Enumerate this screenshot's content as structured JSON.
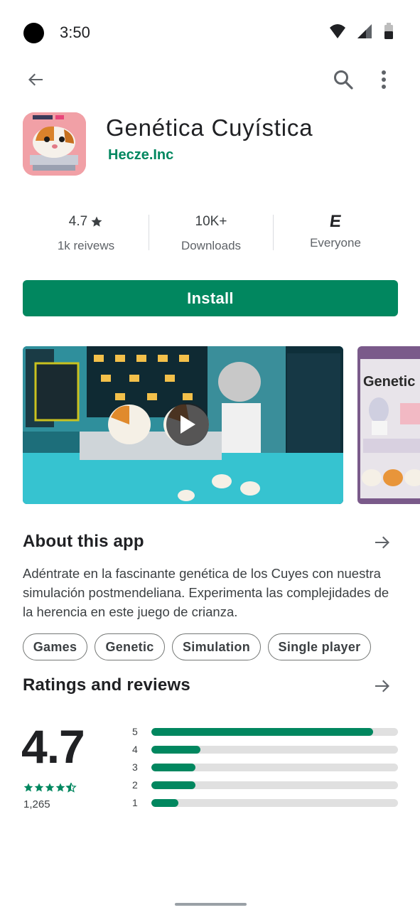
{
  "status_bar": {
    "time": "3:50"
  },
  "app": {
    "title": "Genética Cuyística",
    "developer": "Hecze.Inc",
    "icon": "guinea-pig-pixel-icon"
  },
  "stats": {
    "rating": {
      "value": "4.7",
      "label": "1k reivews"
    },
    "downloads": {
      "value": "10K+",
      "label": "Downloads"
    },
    "content_rating": {
      "value": "E",
      "label": "Everyone"
    }
  },
  "install": {
    "label": "Install"
  },
  "screenshots": {
    "second_text": "Genetic"
  },
  "about": {
    "title": "About this app",
    "description": "Adéntrate en la fascinante genética de los Cuyes con nuestra simulación postmendeliana. Experimenta las complejidades de la herencia en este juego de crianza."
  },
  "tags": [
    "Games",
    "Genetic",
    "Simulation",
    "Single player"
  ],
  "ratings": {
    "title": "Ratings and reviews",
    "average": "4.7",
    "count": "1,265",
    "star_value": 4.5,
    "distribution": [
      {
        "label": "5",
        "fraction": 0.9
      },
      {
        "label": "4",
        "fraction": 0.2
      },
      {
        "label": "3",
        "fraction": 0.18
      },
      {
        "label": "2",
        "fraction": 0.18
      },
      {
        "label": "1",
        "fraction": 0.11
      }
    ]
  },
  "colors": {
    "accent": "#01875f",
    "track": "#e0e0e0"
  }
}
